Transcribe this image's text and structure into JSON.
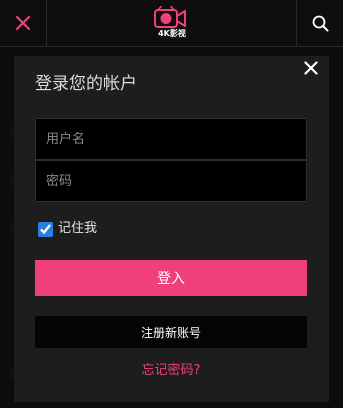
{
  "header": {
    "logo_text": "4K影视"
  },
  "login": {
    "title": "登录您的帐户",
    "username_placeholder": "用户名",
    "password_placeholder": "密码",
    "remember_label": "记住我",
    "remember_checked": true,
    "login_button": "登入",
    "register_button": "注册新账号",
    "forgot_link": "忘记密码?"
  },
  "colors": {
    "accent": "#ef3f7d",
    "background": "#161616",
    "input_background": "#000000"
  },
  "icons": {
    "top_left": "close-icon",
    "top_right": "search-icon",
    "modal_close": "close-icon",
    "logo": "camera-logo-icon"
  }
}
